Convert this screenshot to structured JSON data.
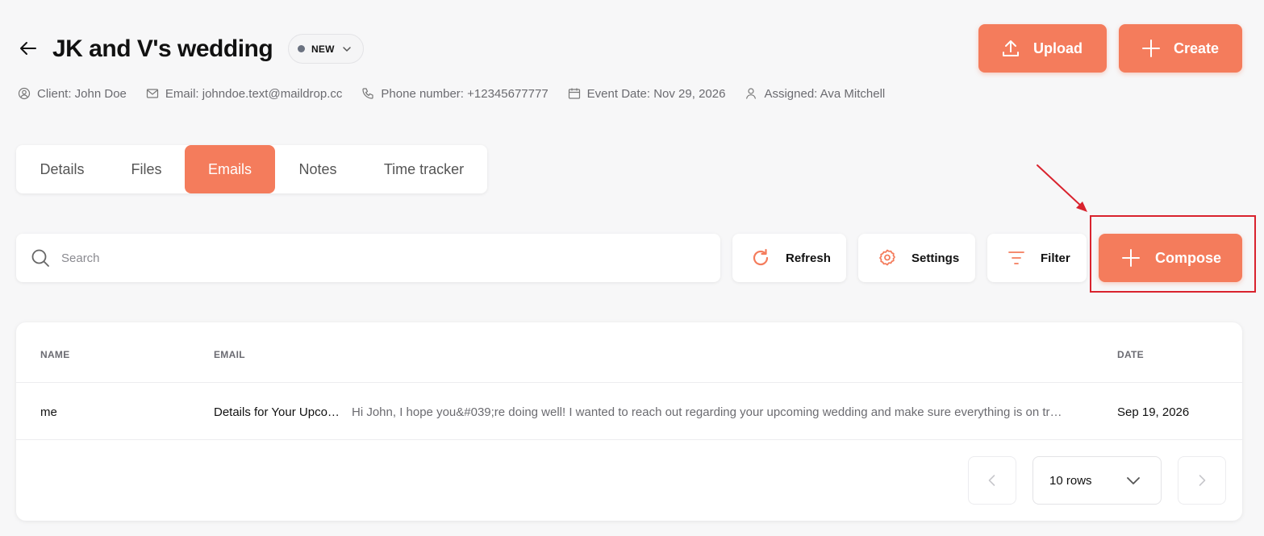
{
  "header": {
    "title": "JK and V's wedding",
    "status": "NEW",
    "upload_label": "Upload",
    "create_label": "Create"
  },
  "meta": {
    "client": "Client: John Doe",
    "email": "Email: johndoe.text@maildrop.cc",
    "phone": "Phone number: +12345677777",
    "event_date": "Event Date: Nov 29, 2026",
    "assigned": "Assigned: Ava Mitchell"
  },
  "tabs": [
    {
      "label": "Details",
      "active": false
    },
    {
      "label": "Files",
      "active": false
    },
    {
      "label": "Emails",
      "active": true
    },
    {
      "label": "Notes",
      "active": false
    },
    {
      "label": "Time tracker",
      "active": false
    }
  ],
  "toolbar": {
    "search_placeholder": "Search",
    "search_value": "",
    "refresh_label": "Refresh",
    "settings_label": "Settings",
    "filter_label": "Filter",
    "compose_label": "Compose"
  },
  "table": {
    "columns": [
      "NAME",
      "EMAIL",
      "DATE"
    ],
    "rows": [
      {
        "name": "me",
        "subject": "Details for Your Upco…",
        "preview": "Hi John, I hope you&#039;re doing well! I wanted to reach out regarding your upcoming wedding and make sure everything is on tr…",
        "date": "Sep 19, 2026"
      }
    ]
  },
  "pagination": {
    "rows_per_page": "10 rows"
  },
  "colors": {
    "accent": "#f47c5c",
    "highlight": "#d9232e",
    "background": "#f7f7f8"
  },
  "icons": [
    "back-arrow-icon",
    "chevron-down-icon",
    "upload-icon",
    "plus-icon",
    "user-circle-icon",
    "mail-icon",
    "phone-icon",
    "calendar-icon",
    "user-icon",
    "search-icon",
    "refresh-icon",
    "gear-icon",
    "filter-icon",
    "chevron-left-icon",
    "chevron-right-icon"
  ]
}
